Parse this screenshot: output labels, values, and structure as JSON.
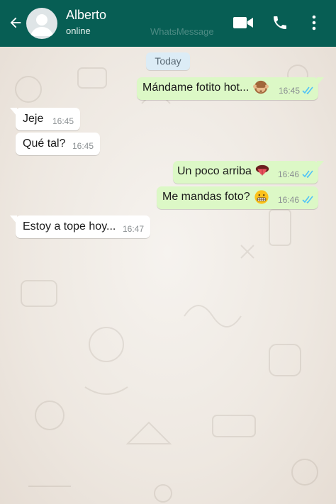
{
  "header": {
    "contact_name": "Alberto",
    "status": "online",
    "watermark": "WhatsMessage",
    "icons": [
      "back-arrow-icon",
      "avatar-placeholder-icon",
      "video-call-icon",
      "phone-call-icon",
      "more-vertical-icon"
    ]
  },
  "chat": {
    "date_label": "Today",
    "messages": [
      {
        "direction": "outgoing",
        "text": "Mándame fotito hot...",
        "emoji": "see-no-evil-monkey-emoji",
        "time": "16:45",
        "status": "read"
      },
      {
        "direction": "incoming",
        "text": "Jeje",
        "time": "16:45"
      },
      {
        "direction": "incoming",
        "text": "Qué tal?",
        "time": "16:45"
      },
      {
        "direction": "outgoing",
        "text": "Un poco arriba",
        "emoji": "tongue-emoji",
        "time": "16:46",
        "status": "read"
      },
      {
        "direction": "outgoing",
        "text": "Me mandas foto?",
        "emoji": "grimacing-face-emoji",
        "time": "16:46",
        "status": "read"
      },
      {
        "direction": "incoming",
        "text": "Estoy a tope hoy...",
        "time": "16:47"
      }
    ]
  },
  "colors": {
    "header": "#075e54",
    "outgoing_bubble": "#dcf8c6",
    "incoming_bubble": "#ffffff",
    "read_ticks": "#4fc3f7",
    "date_chip": "#dcecf6"
  }
}
